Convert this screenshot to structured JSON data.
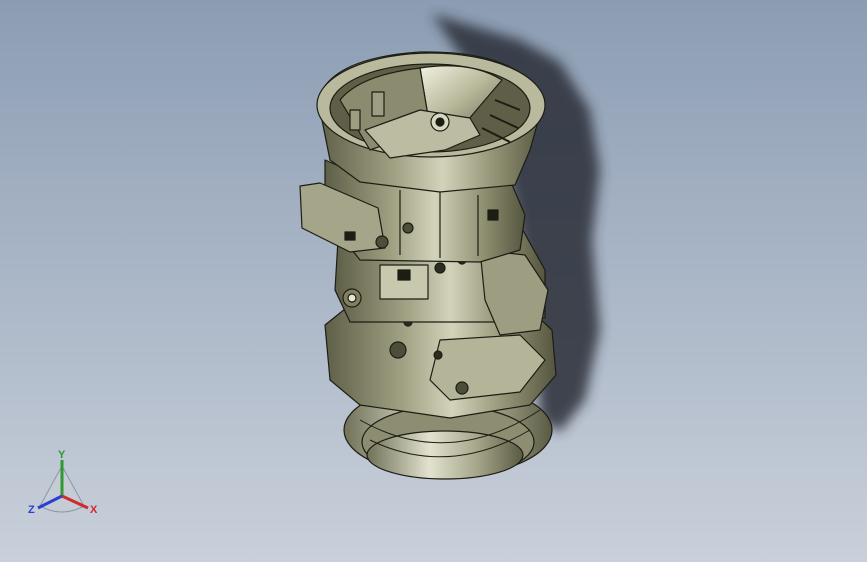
{
  "viewport": {
    "background_top": "#8c9db3",
    "background_bottom": "#c9d0da",
    "model": {
      "name": "transmission-housing-assembly",
      "shade_color": "#6f7056",
      "highlight_color": "#d9d9c2",
      "edge_color": "#1d1d14",
      "shadow_color": "#2a2f38"
    }
  },
  "triad": {
    "x_label": "X",
    "y_label": "Y",
    "z_label": "Z",
    "x_color": "#d22a2a",
    "y_color": "#2f9a2f",
    "z_color": "#2c3fd0"
  }
}
